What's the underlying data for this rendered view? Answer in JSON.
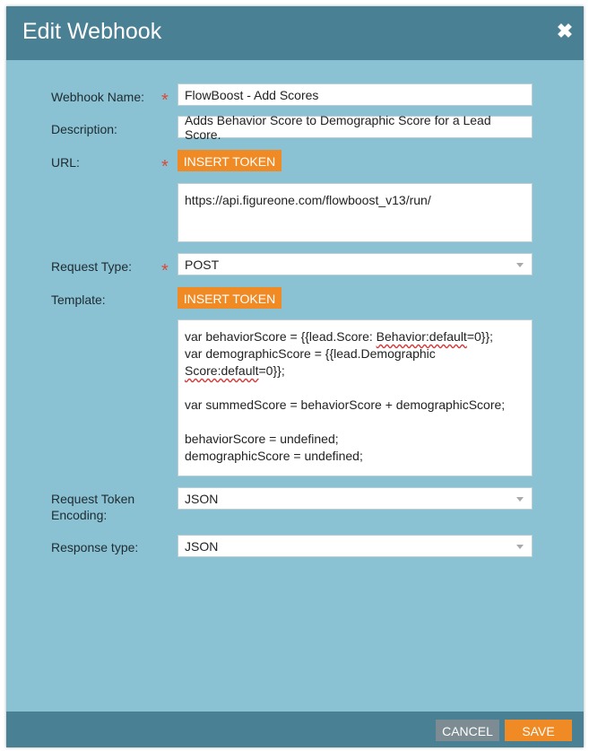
{
  "dialog": {
    "title": "Edit Webhook",
    "close_icon": "close-icon"
  },
  "form": {
    "webhook_name": {
      "label": "Webhook Name:",
      "value": "FlowBoost - Add Scores",
      "required": "*"
    },
    "description": {
      "label": "Description:",
      "value": "Adds Behavior Score to Demographic Score for a Lead Score."
    },
    "url": {
      "label": "URL:",
      "required": "*",
      "insert_token": "INSERT TOKEN",
      "value": "https://api.figureone.com/flowboost_v13/run/"
    },
    "request_type": {
      "label": "Request Type:",
      "required": "*",
      "value": "POST"
    },
    "template": {
      "label": "Template:",
      "insert_token": "INSERT TOKEN",
      "lines": {
        "l1a": "var behaviorScore = {{lead.Score: ",
        "l1b": "Behavior:default",
        "l1c": "=0}};",
        "l2": "var demographicScore = {{lead.Demographic",
        "l3a": "Score:default",
        "l3b": "=0}};",
        "l4": "var summedScore = behaviorScore + demographicScore;",
        "l5": "behaviorScore = undefined;",
        "l6": "demographicScore = undefined;"
      }
    },
    "request_token_encoding": {
      "label_line1": "Request Token",
      "label_line2": "Encoding:",
      "value": "JSON"
    },
    "response_type": {
      "label": "Response type:",
      "value": "JSON"
    }
  },
  "footer": {
    "cancel_label": "CANCEL",
    "save_label": "SAVE"
  },
  "colors": {
    "header": "#4a8093",
    "body": "#8ac2d4",
    "accent": "#f08a24",
    "cancel": "#7c8c92",
    "required": "#d84a3a"
  }
}
